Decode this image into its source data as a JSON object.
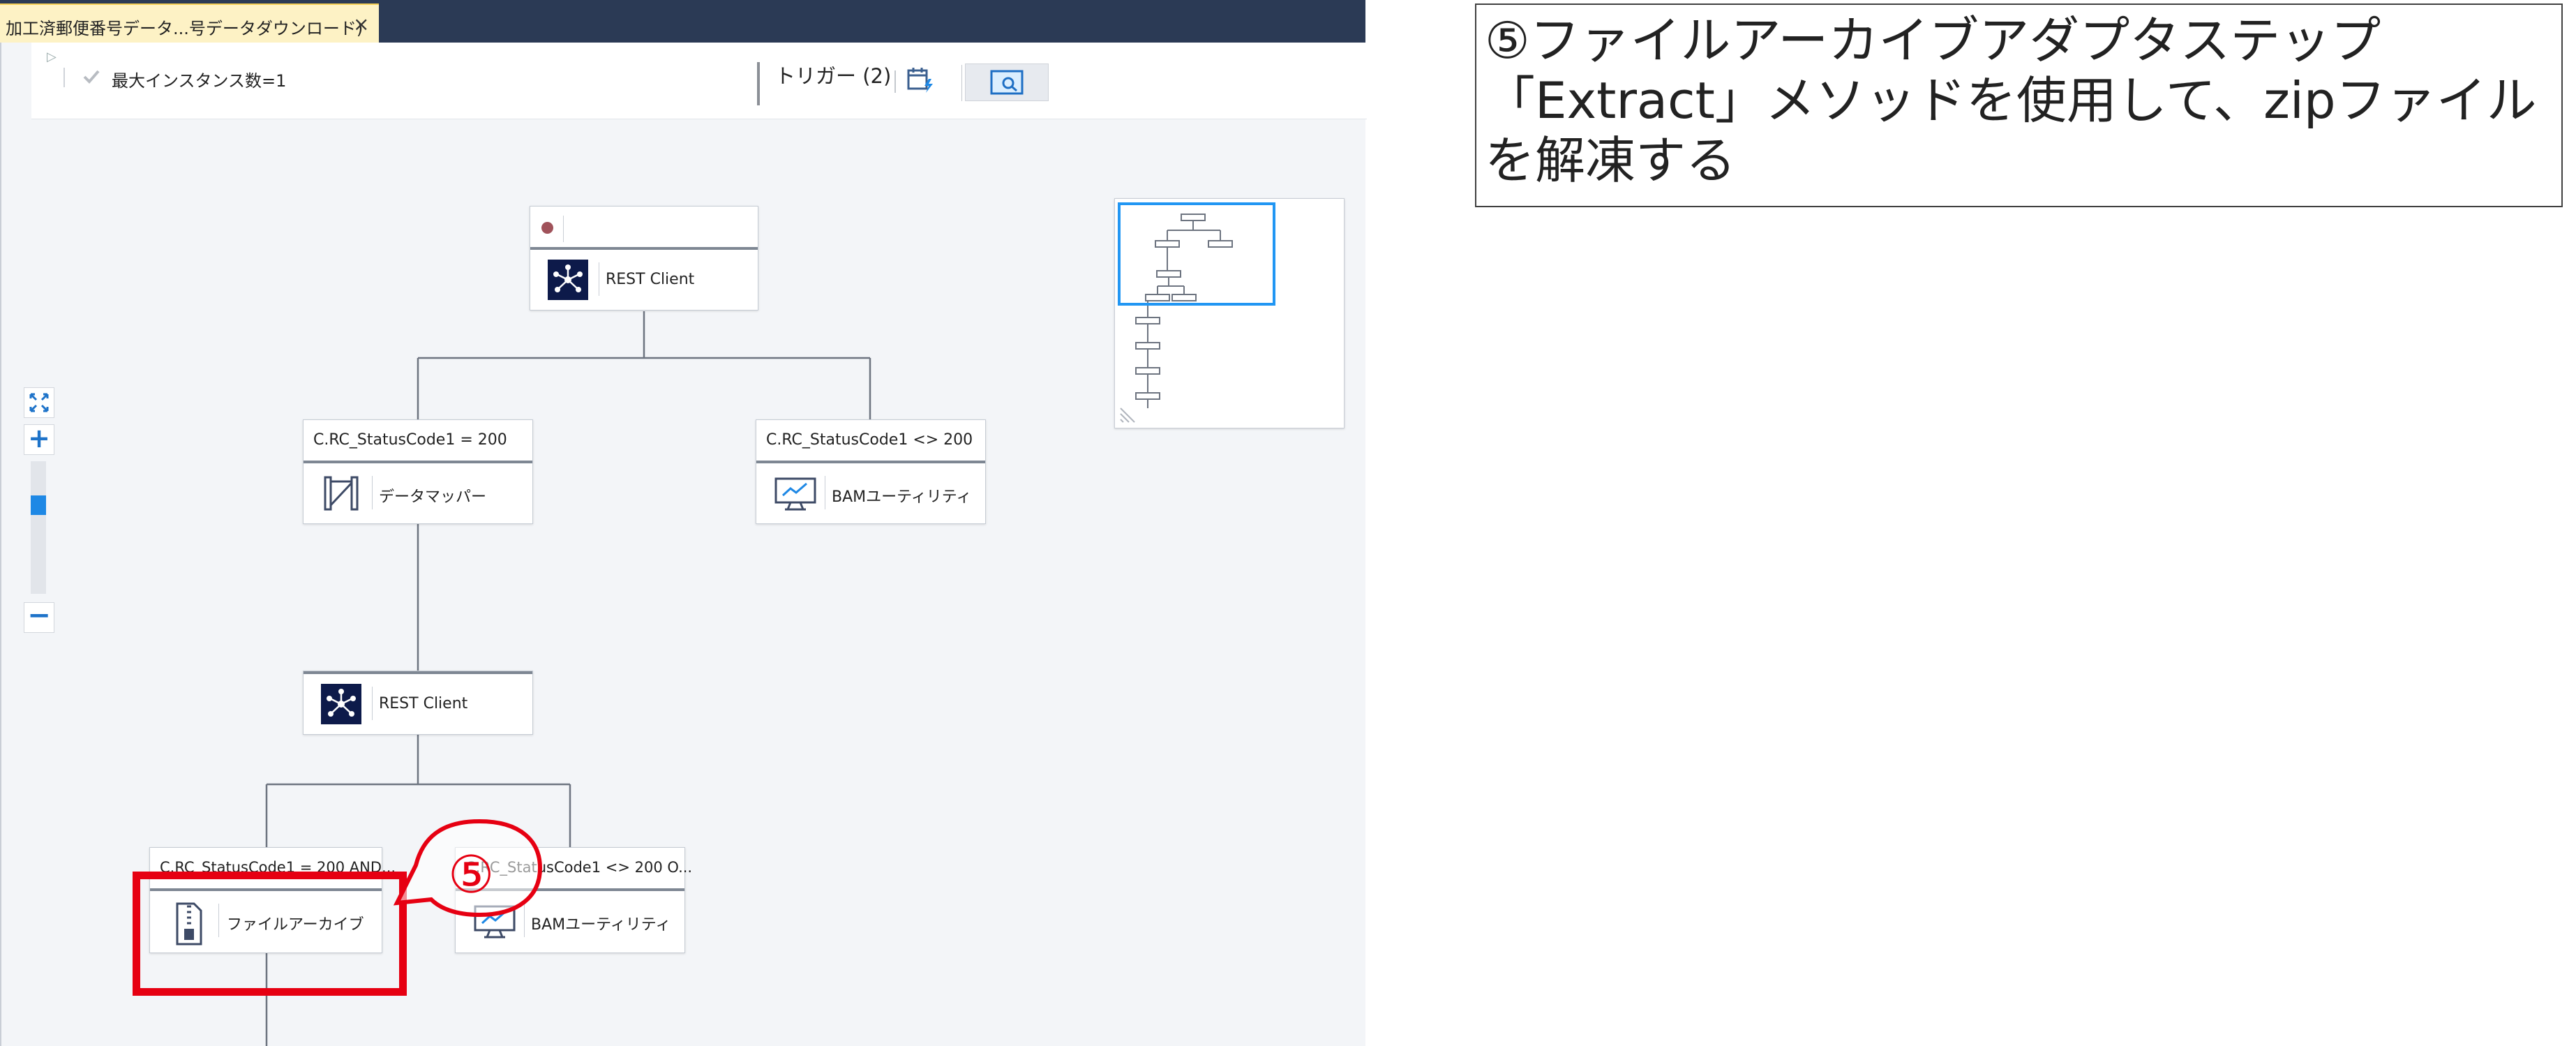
{
  "window": {
    "tab_title": "加工済郵便番号データ...号データダウンロード)",
    "tab_close": "×"
  },
  "toolbar": {
    "max_instances": "最大インスタンス数=1",
    "triggers": "トリガー (2)",
    "icons": [
      "collapse-arrow-icon",
      "check-icon",
      "calendar-lightning-icon",
      "map-search-icon"
    ]
  },
  "zoom": {
    "level_fraction": 0.3,
    "icons": [
      "fit-icon",
      "zoom-in-icon",
      "zoom-out-icon"
    ]
  },
  "flow": {
    "nodes": [
      {
        "id": "rest1",
        "condition": "",
        "label": "REST Client",
        "icon": "network-icon",
        "start": true
      },
      {
        "id": "mapper",
        "condition": "C.RC_StatusCode1 = 200",
        "label": "データマッパー",
        "icon": "data-mapper-icon"
      },
      {
        "id": "bam1",
        "condition": "C.RC_StatusCode1 <> 200",
        "label": "BAMユーティリティ",
        "icon": "monitor-chart-icon"
      },
      {
        "id": "rest2",
        "condition": "",
        "label": "REST Client",
        "icon": "network-icon"
      },
      {
        "id": "archive",
        "condition": "C.RC_StatusCode1 = 200 AND...",
        "label": "ファイルアーカイブ",
        "icon": "zip-file-icon"
      },
      {
        "id": "bam2",
        "condition": "C.RC_StatusCode1 <> 200 O...",
        "label": "BAMユーティリティ",
        "icon": "monitor-chart-icon"
      }
    ]
  },
  "callout": {
    "number": "⑤",
    "color": "#e60012"
  },
  "annotation": {
    "lines": [
      "⑤ファイルアーカイブアダプタステップ",
      "「Extract」メソッドを使用して、zipファイル",
      "を解凍する"
    ]
  },
  "colors": {
    "tab_strip": "#2b3a55",
    "active_tab": "#fdf2c5",
    "canvas": "#f3f5f8",
    "accent": "#1e88e5",
    "node_icon_bg": "#0d1a4a",
    "highlight": "#e60012"
  }
}
